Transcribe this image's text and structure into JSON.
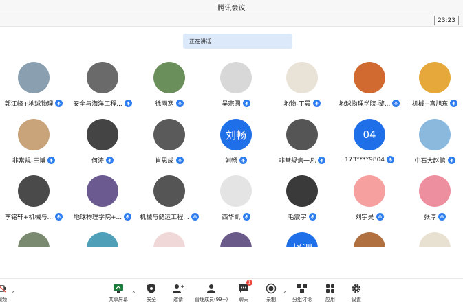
{
  "window": {
    "title": "腾讯会议",
    "clock": "23:23"
  },
  "speaking": {
    "label": "正在讲话:"
  },
  "participants": [
    {
      "name": "郭江峰+地球物理",
      "avatar_color": "#8aa0b0"
    },
    {
      "name": "安全与海洋工程...",
      "avatar_color": "#6a6a6a"
    },
    {
      "name": "徐雨寒",
      "avatar_color": "#6b8f5a"
    },
    {
      "name": "吴宗圆",
      "avatar_color": "#d8d8d8"
    },
    {
      "name": "地物-丁晨",
      "avatar_color": "#e9e2d6"
    },
    {
      "name": "地球物理学院-黎...",
      "avatar_color": "#d06a30"
    },
    {
      "name": "机械+宫旭东",
      "avatar_color": "#e6a83a"
    },
    {
      "name": "非常规-王博",
      "avatar_color": "#c9a37a"
    },
    {
      "name": "何涛",
      "avatar_color": "#444444"
    },
    {
      "name": "肖思成",
      "avatar_color": "#5a5a5a"
    },
    {
      "name": "刘畅",
      "avatar_color": "#1e6fe8",
      "avatar_text": "刘畅"
    },
    {
      "name": "非常规焦一凡",
      "avatar_color": "#555555"
    },
    {
      "name": "173****9804",
      "avatar_color": "#1e6fe8",
      "avatar_text": "04"
    },
    {
      "name": "中石大赵鹏",
      "avatar_color": "#8bb8dd"
    },
    {
      "name": "李铭轩+机械与...",
      "avatar_color": "#4a4a4a"
    },
    {
      "name": "地球物理学院+...",
      "avatar_color": "#6a5a90"
    },
    {
      "name": "机械与储运工程...",
      "avatar_color": "#555555"
    },
    {
      "name": "西华凯",
      "avatar_color": "#e4e4e4"
    },
    {
      "name": "毛震宇",
      "avatar_color": "#3a3a3a"
    },
    {
      "name": "刘宇昊",
      "avatar_color": "#f6a0a0"
    },
    {
      "name": "张淳",
      "avatar_color": "#ee8fa0"
    },
    {
      "name": "",
      "avatar_color": "#7a8a70"
    },
    {
      "name": "",
      "avatar_color": "#4f9fb8"
    },
    {
      "name": "",
      "avatar_color": "#f0d8d8"
    },
    {
      "name": "",
      "avatar_color": "#6a5a8a"
    },
    {
      "name": "",
      "avatar_color": "#1e6fe8",
      "avatar_text": "赵洲"
    },
    {
      "name": "",
      "avatar_color": "#b07040"
    },
    {
      "name": "",
      "avatar_color": "#e8e0d0"
    }
  ],
  "toolbar": {
    "video_label": "视频",
    "share_label": "共享屏幕",
    "security_label": "安全",
    "invite_label": "邀请",
    "members_label": "管理成员(99+)",
    "chat_label": "聊天",
    "chat_badge": "1",
    "record_label": "录制",
    "breakout_label": "分组讨论",
    "apps_label": "应用",
    "settings_label": "设置"
  }
}
